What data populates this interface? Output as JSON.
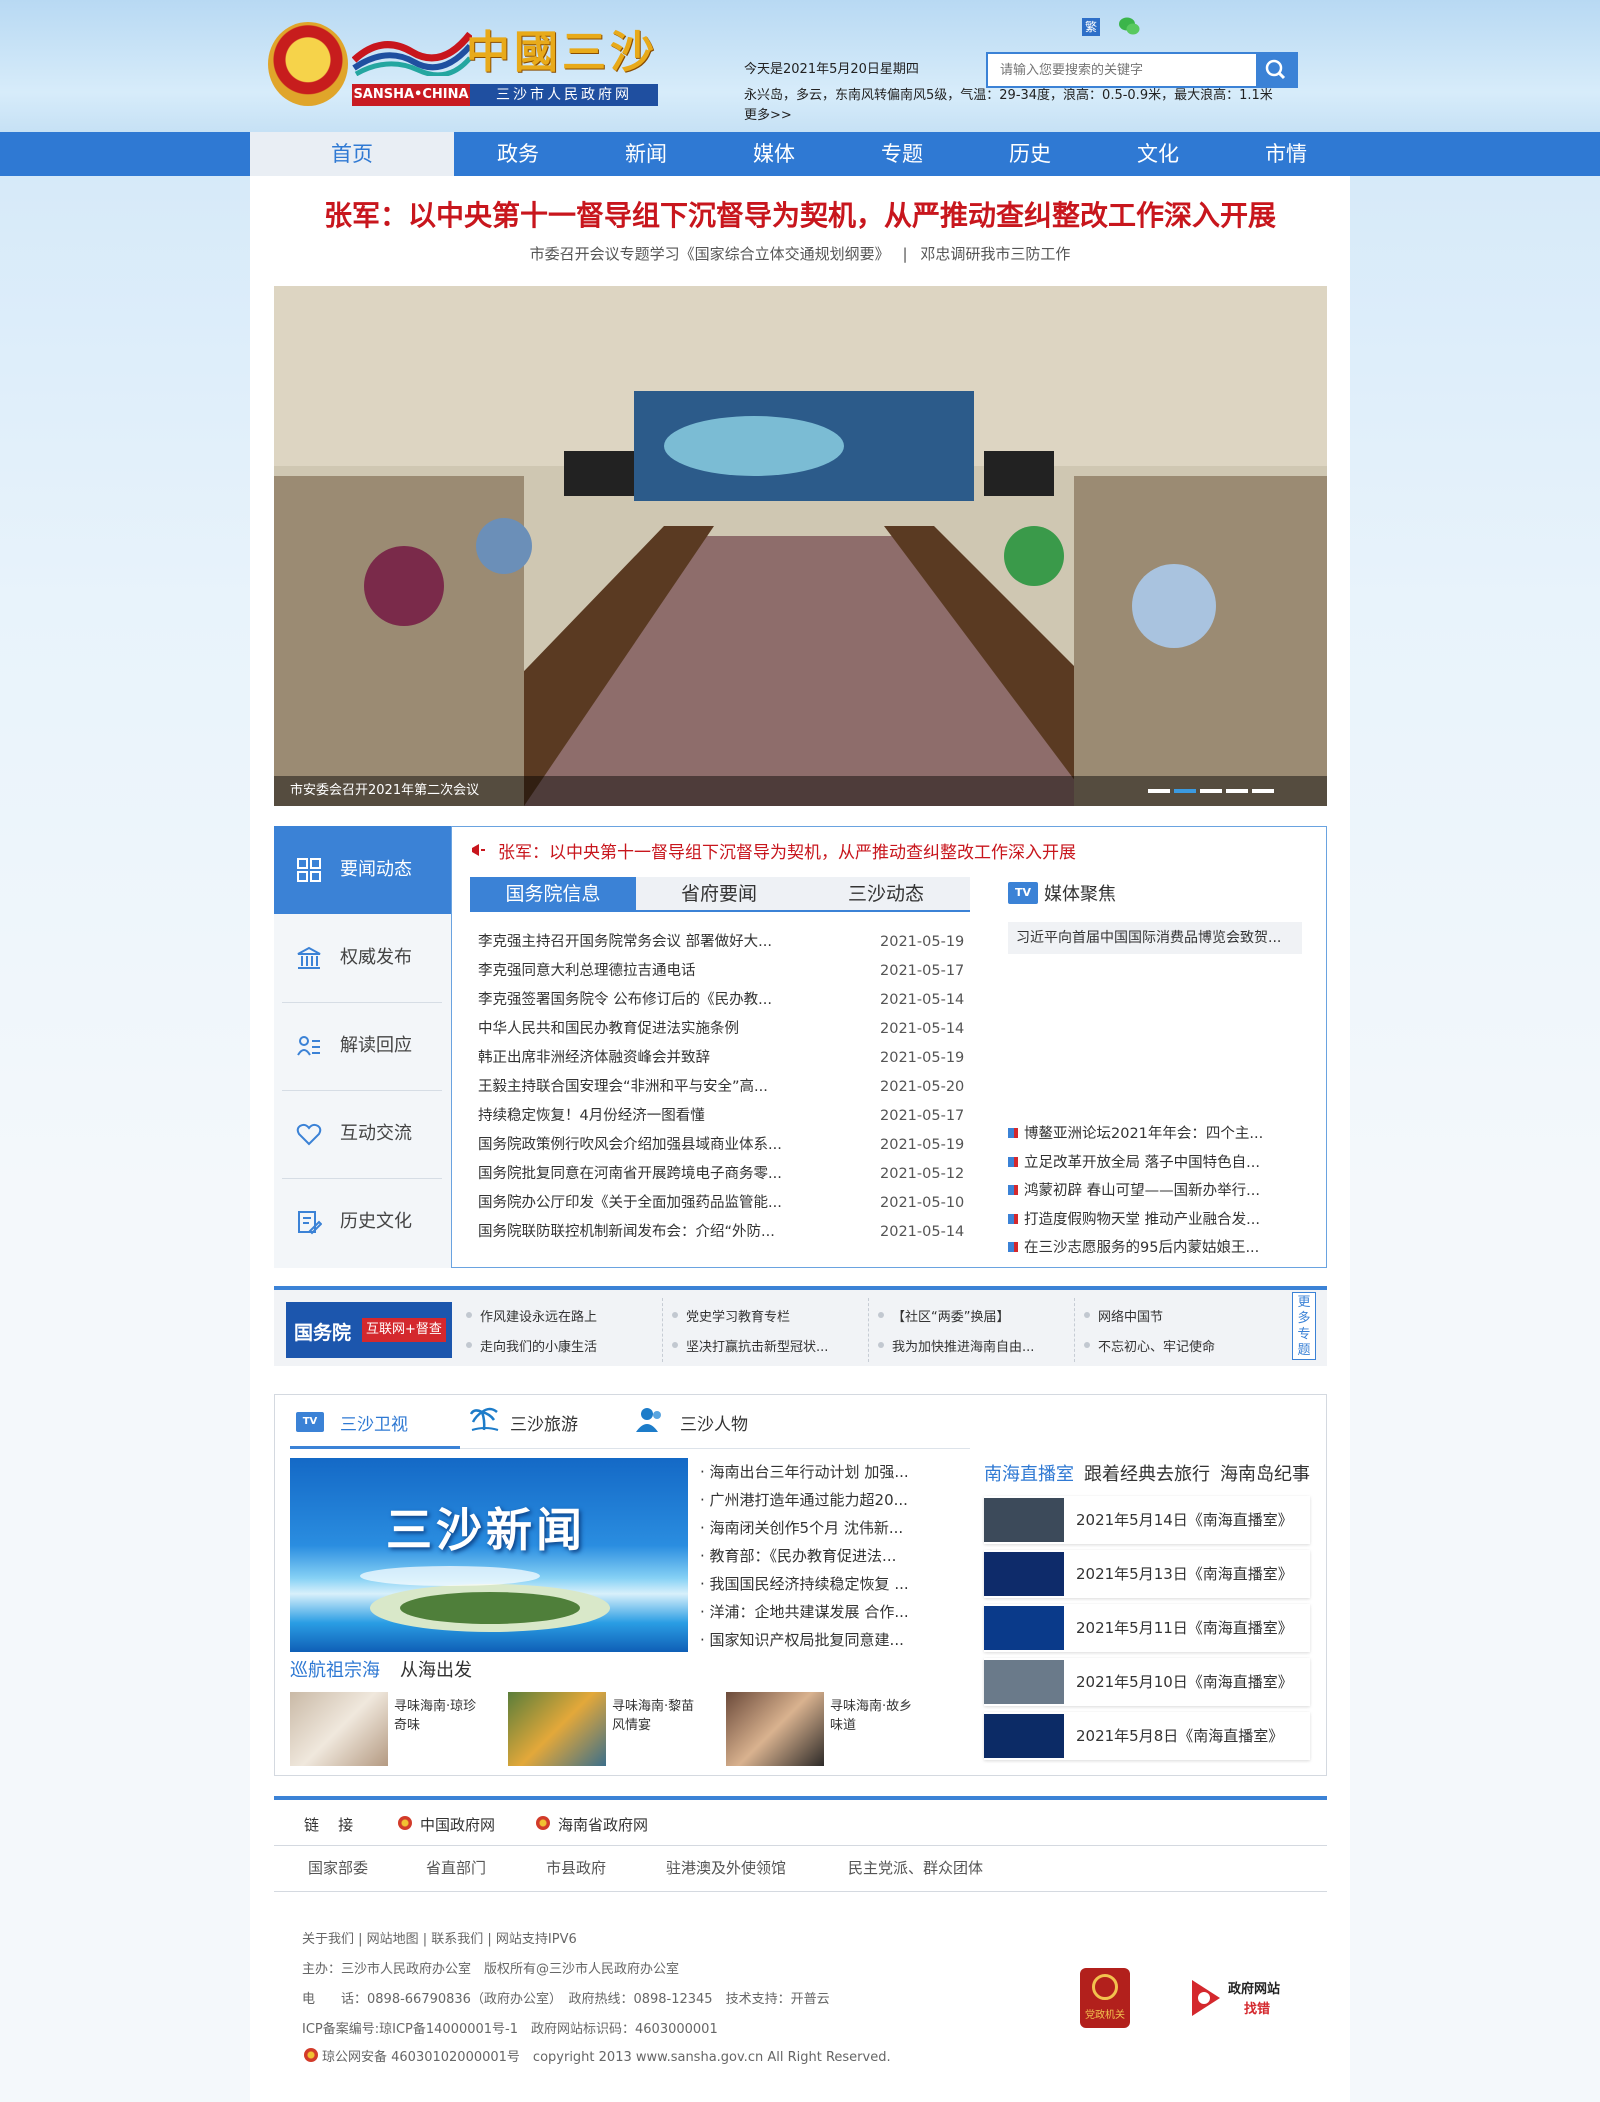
{
  "header": {
    "logo_title": "中國三沙",
    "logo_en": "SANSHA•CHINA",
    "logo_cn": "三沙市人民政府网",
    "lang_toggle": "繁",
    "date": "今天是2021年5月20日星期四",
    "weather": "永兴岛，多云，东南风转偏南风5级，气温：29-34度，浪高：0.5-0.9米，最大浪高：1.1米",
    "weather_more": "更多>>",
    "search_placeholder": "请输入您要搜索的关键字"
  },
  "nav": [
    "首页",
    "政务",
    "新闻",
    "媒体",
    "专题",
    "历史",
    "文化",
    "市情"
  ],
  "headline": "张军：以中央第十一督导组下沉督导为契机，从严推动查纠整改工作深入开展",
  "subheads": [
    "市委召开会议专题学习《国家综合立体交通规划纲要》",
    "|",
    "邓忠调研我市三防工作"
  ],
  "slide_caption": "市安委会召开2021年第二次会议",
  "side_menu": [
    "要闻动态",
    "权威发布",
    "解读回应",
    "互动交流",
    "历史文化"
  ],
  "hot_news": "张军：以中央第十一督导组下沉督导为契机，从严推动查纠整改工作深入开展",
  "news_tabs": [
    "国务院信息",
    "省府要闻",
    "三沙动态"
  ],
  "news_list": [
    {
      "title": "李克强主持召开国务院常务会议 部署做好大...",
      "date": "2021-05-19"
    },
    {
      "title": "李克强同意大利总理德拉吉通电话",
      "date": "2021-05-17"
    },
    {
      "title": "李克强签署国务院令 公布修订后的《民办教...",
      "date": "2021-05-14"
    },
    {
      "title": "中华人民共和国民办教育促进法实施条例",
      "date": "2021-05-14"
    },
    {
      "title": "韩正出席非洲经济体融资峰会并致辞",
      "date": "2021-05-19"
    },
    {
      "title": "王毅主持联合国安理会“非洲和平与安全”高...",
      "date": "2021-05-20"
    },
    {
      "title": "持续稳定恢复！4月份经济一图看懂",
      "date": "2021-05-17"
    },
    {
      "title": "国务院政策例行吹风会介绍加强县域商业体系...",
      "date": "2021-05-19"
    },
    {
      "title": "国务院批复同意在河南省开展跨境电子商务零...",
      "date": "2021-05-12"
    },
    {
      "title": "国务院办公厅印发《关于全面加强药品监管能...",
      "date": "2021-05-10"
    },
    {
      "title": "国务院联防联控机制新闻发布会：介绍“外防...",
      "date": "2021-05-14"
    }
  ],
  "media_focus": {
    "tv": "TV",
    "title": "媒体聚焦",
    "feature": "习近平向首届中国国际消费品博览会致贺...",
    "items": [
      "博鳌亚洲论坛2021年年会：四个主...",
      "立足改革开放全局 落子中国特色自...",
      "鸿蒙初辟 春山可望——国新办举行...",
      "打造度假购物天堂 推动产业融合发...",
      "在三沙志愿服务的95后内蒙姑娘王..."
    ]
  },
  "special_bar": {
    "logo_main": "国务院",
    "logo_tag": "互联网+督查",
    "links_top": [
      "作风建设永远在路上",
      "党史学习教育专栏",
      "【社区“两委”换届】",
      "网络中国节"
    ],
    "links_bottom": [
      "走向我们的小康生活",
      "坚决打赢抗击新型冠状...",
      "我为加快推进海南自由...",
      "不忘初心、牢记使命"
    ],
    "more": "更多专题"
  },
  "media_section": {
    "tabs": [
      "三沙卫视",
      "三沙旅游",
      "三沙人物"
    ],
    "feature_title": "三沙新闻",
    "feature_cap1": "巡航祖宗海",
    "feature_cap2": "从海出发",
    "list": [
      "海南出台三年行动计划 加强...",
      "广州港打造年通过能力超20...",
      "海南闭关创作5个月 沈伟新...",
      "教育部：《民办教育促进法...",
      "我国国民经济持续稳定恢复 ...",
      "洋浦：企地共建谋发展 合作...",
      "国家知识产权局批复同意建..."
    ],
    "thumbs": [
      {
        "cap": "寻味海南·琼珍奇味"
      },
      {
        "cap": "寻味海南·黎苗风情宴"
      },
      {
        "cap": "寻味海南·故乡味道"
      }
    ],
    "live_tabs": [
      "南海直播室",
      "跟着经典去旅行",
      "海南岛纪事"
    ],
    "live_list": [
      "2021年5月14日《南海直播室》",
      "2021年5月13日《南海直播室》",
      "2021年5月11日《南海直播室》",
      "2021年5月10日《南海直播室》",
      "2021年5月8日《南海直播室》"
    ]
  },
  "links": {
    "label": "链    接",
    "gov": [
      "中国政府网",
      "海南省政府网"
    ],
    "categories": [
      "国家部委",
      "省直部门",
      "市县政府",
      "驻港澳及外使领馆",
      "民主党派、群众团体"
    ]
  },
  "footer": {
    "line1": "关于我们 | 网站地图 | 联系我们 | 网站支持IPV6",
    "line2": "主办：三沙市人民政府办公室　版权所有@三沙市人民政府办公室",
    "line3": "电　　话：0898-66790836（政府办公室）　政府热线：0898-12345　技术支持：开普云",
    "line4": "ICP备案编号:琼ICP备14000001号-1　政府网站标识码：4603000001",
    "line5": "琼公网安备 46030102000001号　copyright 2013 www.sansha.gov.cn All Right Reserved.",
    "badge_party": "党政机关",
    "badge_find1": "政府网站",
    "badge_find2": "找错"
  },
  "colors": {
    "primary": "#2f79d3",
    "accent_red": "#c8161d"
  }
}
